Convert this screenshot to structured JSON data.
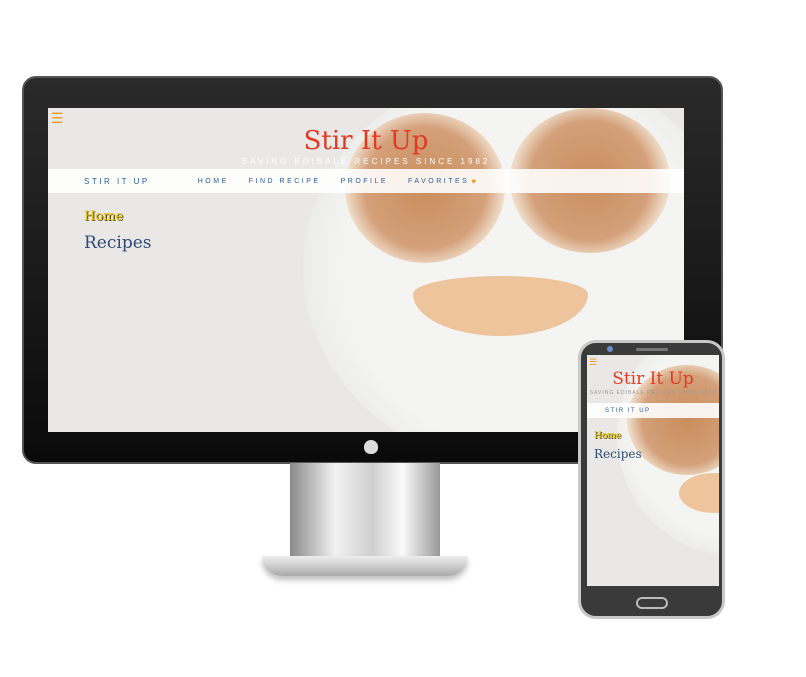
{
  "site": {
    "title": "Stir It Up",
    "tagline": "SAVING EDIBALE RECIPES SINCE 1982",
    "brand": "STIR IT UP",
    "nav": [
      "HOME",
      "FIND RECIPE",
      "PROFILE",
      "FAVORITES"
    ],
    "favorites_icon": "♥",
    "menu_icon": "☰",
    "breadcrumb": "Home",
    "heading": "Recipes"
  },
  "colors": {
    "title": "#e23a22",
    "nav": "#2a5d9c",
    "accent": "#f19a1b",
    "home": "#e8c400",
    "heading": "#2e4a75"
  }
}
